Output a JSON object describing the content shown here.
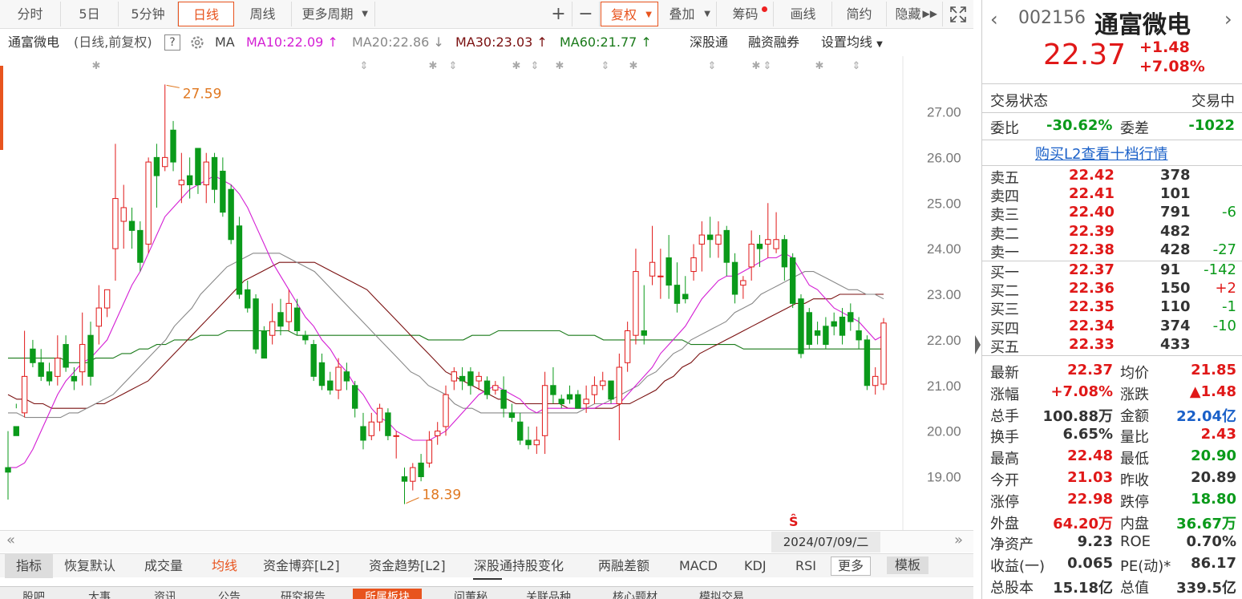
{
  "toolbar": {
    "tabs": [
      "分时",
      "5日",
      "5分钟",
      "日线",
      "周线",
      "更多周期"
    ],
    "active": "日线",
    "right": [
      "+",
      "−",
      "复权",
      "叠加",
      "筹码",
      "画线",
      "简约",
      "隐藏"
    ]
  },
  "ma_row": {
    "stock": "通富微电",
    "mode": "(日线,前复权)",
    "help": "?",
    "ma": "MA",
    "ma10": "MA10:22.09",
    "ma20": "MA20:22.86",
    "ma30": "MA30:23.03",
    "ma60": "MA60:21.77",
    "up": "↑",
    "down": "↓",
    "links": [
      "深股通",
      "融资融券",
      "设置均线"
    ]
  },
  "chart_data": {
    "type": "candlestick",
    "ylim": [
      18.2,
      27.8
    ],
    "yticks": [
      "27.00",
      "26.00",
      "25.00",
      "24.00",
      "23.00",
      "22.00",
      "21.00",
      "20.00",
      "19.00"
    ],
    "max_label": "27.59",
    "min_label": "18.39",
    "date_label": "2024/07/09/二",
    "candles": [
      [
        19.2,
        20.0,
        19.1,
        18.5
      ],
      [
        20.1,
        20.6,
        19.9,
        20.5
      ],
      [
        20.4,
        22.2,
        21.2,
        20.3
      ],
      [
        21.8,
        22.0,
        21.5,
        21.4
      ],
      [
        21.5,
        21.8,
        21.2,
        21.1
      ],
      [
        21.3,
        21.5,
        21.1,
        21.0
      ],
      [
        21.2,
        22.1,
        21.6,
        21.0
      ],
      [
        21.9,
        22.1,
        21.4,
        21.3
      ],
      [
        21.2,
        21.4,
        21.1,
        20.9
      ],
      [
        21.3,
        22.6,
        21.9,
        21.0
      ],
      [
        22.1,
        22.4,
        21.2,
        21.0
      ],
      [
        22.3,
        23.2,
        22.7,
        21.9
      ],
      [
        22.7,
        23.0,
        23.1,
        22.5
      ],
      [
        24.0,
        26.3,
        25.1,
        23.3
      ],
      [
        24.6,
        25.4,
        24.9,
        24.0
      ],
      [
        24.6,
        24.9,
        24.4,
        24.0
      ],
      [
        24.4,
        24.6,
        23.7,
        23.5
      ],
      [
        24.1,
        26.0,
        25.9,
        23.9
      ],
      [
        26.0,
        26.3,
        25.6,
        24.9
      ],
      [
        25.8,
        27.6,
        26.0,
        25.7
      ],
      [
        26.6,
        26.8,
        25.9,
        25.7
      ],
      [
        25.4,
        26.1,
        25.5,
        25.0
      ],
      [
        25.6,
        26.0,
        25.4,
        25.1
      ],
      [
        26.2,
        26.2,
        25.4,
        25.2
      ],
      [
        25.4,
        26.1,
        25.9,
        25.0
      ],
      [
        26.0,
        26.1,
        25.3,
        25.0
      ],
      [
        25.7,
        26.0,
        24.8,
        24.7
      ],
      [
        25.3,
        25.4,
        24.2,
        24.1
      ],
      [
        24.5,
        24.7,
        23.0,
        22.9
      ],
      [
        23.1,
        23.3,
        22.7,
        22.6
      ],
      [
        22.9,
        23.0,
        21.8,
        21.7
      ],
      [
        22.2,
        22.3,
        21.6,
        21.6
      ],
      [
        22.1,
        22.8,
        22.4,
        21.9
      ],
      [
        22.6,
        22.9,
        22.3,
        22.1
      ],
      [
        22.4,
        23.1,
        22.8,
        22.2
      ],
      [
        22.7,
        22.9,
        22.2,
        22.1
      ],
      [
        22.1,
        22.2,
        22.0,
        21.9
      ],
      [
        21.9,
        22.0,
        21.2,
        21.1
      ],
      [
        21.5,
        21.7,
        21.0,
        20.9
      ],
      [
        21.1,
        21.3,
        20.9,
        20.8
      ],
      [
        20.9,
        21.6,
        21.4,
        20.7
      ],
      [
        21.3,
        21.5,
        21.1,
        20.9
      ],
      [
        21.0,
        21.1,
        20.5,
        20.3
      ],
      [
        20.1,
        20.4,
        19.8,
        19.6
      ],
      [
        19.9,
        20.4,
        20.2,
        19.8
      ],
      [
        20.2,
        20.6,
        20.5,
        20.0
      ],
      [
        20.4,
        20.5,
        19.9,
        19.8
      ],
      [
        19.9,
        20.0,
        19.9,
        19.4
      ],
      [
        19.0,
        19.2,
        18.9,
        18.4
      ],
      [
        18.9,
        19.3,
        19.2,
        18.7
      ],
      [
        19.3,
        19.5,
        19.0,
        18.9
      ],
      [
        19.3,
        20.0,
        19.8,
        19.2
      ],
      [
        19.9,
        20.2,
        20.0,
        19.7
      ],
      [
        20.1,
        21.0,
        20.8,
        19.9
      ],
      [
        21.1,
        21.4,
        21.3,
        20.9
      ],
      [
        21.2,
        21.4,
        21.1,
        20.9
      ],
      [
        21.3,
        21.4,
        21.0,
        20.8
      ],
      [
        21.1,
        21.3,
        21.2,
        20.9
      ],
      [
        21.1,
        21.2,
        20.8,
        20.7
      ],
      [
        20.9,
        21.1,
        21.0,
        20.8
      ],
      [
        20.9,
        21.2,
        20.5,
        20.3
      ],
      [
        20.4,
        20.6,
        20.3,
        20.2
      ],
      [
        20.2,
        20.4,
        19.8,
        19.7
      ],
      [
        19.8,
        20.1,
        19.7,
        19.6
      ],
      [
        19.7,
        20.1,
        19.8,
        19.5
      ],
      [
        19.9,
        21.3,
        21.0,
        19.5
      ],
      [
        21.0,
        21.4,
        20.8,
        20.6
      ],
      [
        20.7,
        20.8,
        20.6,
        20.5
      ],
      [
        20.8,
        21.0,
        20.7,
        20.6
      ],
      [
        20.8,
        20.9,
        20.5,
        20.5
      ],
      [
        20.6,
        21.0,
        20.7,
        20.4
      ],
      [
        20.8,
        21.2,
        21.0,
        20.6
      ],
      [
        21.0,
        21.3,
        21.1,
        20.9
      ],
      [
        21.1,
        21.1,
        20.7,
        20.6
      ],
      [
        20.6,
        21.7,
        21.4,
        19.8
      ],
      [
        21.5,
        22.4,
        22.2,
        21.3
      ],
      [
        22.1,
        24.0,
        23.5,
        21.9
      ],
      [
        22.2,
        23.2,
        22.1,
        21.9
      ],
      [
        23.4,
        24.5,
        23.7,
        23.2
      ],
      [
        23.4,
        24.0,
        23.4,
        22.9
      ],
      [
        23.8,
        24.3,
        23.2,
        22.9
      ],
      [
        23.2,
        23.7,
        22.8,
        22.6
      ],
      [
        23.0,
        23.4,
        22.9,
        22.8
      ],
      [
        23.5,
        24.1,
        23.8,
        23.3
      ],
      [
        24.1,
        24.6,
        24.3,
        23.5
      ],
      [
        24.3,
        24.7,
        24.2,
        23.8
      ],
      [
        24.1,
        24.6,
        24.3,
        23.8
      ],
      [
        24.4,
        24.5,
        23.7,
        23.4
      ],
      [
        23.7,
        23.9,
        23.0,
        22.8
      ],
      [
        23.2,
        23.4,
        23.3,
        22.9
      ],
      [
        23.6,
        24.4,
        24.1,
        23.3
      ],
      [
        24.1,
        24.3,
        24.0,
        23.6
      ],
      [
        24.1,
        25.0,
        24.2,
        23.8
      ],
      [
        24.0,
        24.8,
        24.2,
        23.9
      ],
      [
        24.2,
        24.3,
        23.6,
        23.3
      ],
      [
        23.8,
        23.9,
        22.8,
        22.7
      ],
      [
        22.9,
        23.0,
        21.7,
        21.6
      ],
      [
        22.6,
        22.7,
        21.9,
        21.8
      ],
      [
        22.2,
        22.4,
        22.1,
        21.9
      ],
      [
        22.3,
        22.5,
        21.9,
        21.8
      ],
      [
        22.4,
        22.6,
        22.3,
        22.1
      ],
      [
        22.5,
        22.7,
        22.1,
        21.9
      ],
      [
        22.6,
        22.8,
        22.4,
        22.2
      ],
      [
        22.2,
        22.5,
        22.0,
        21.8
      ],
      [
        22.0,
        22.1,
        21.0,
        20.9
      ],
      [
        21.0,
        21.4,
        21.2,
        20.8
      ],
      [
        21.03,
        22.48,
        22.37,
        20.9
      ]
    ],
    "ma_series": {
      "ma10": [
        19.2,
        19.2,
        19.3,
        19.6,
        20.0,
        20.4,
        20.8,
        21.1,
        21.3,
        21.5,
        21.6,
        21.8,
        22.0,
        22.4,
        22.8,
        23.2,
        23.5,
        23.9,
        24.3,
        24.7,
        24.9,
        25.1,
        25.3,
        25.4,
        25.5,
        25.6,
        25.5,
        25.4,
        25.2,
        24.9,
        24.5,
        24.1,
        23.7,
        23.4,
        23.1,
        22.8,
        22.5,
        22.3,
        22.0,
        21.8,
        21.5,
        21.3,
        21.0,
        20.8,
        20.5,
        20.3,
        20.2,
        20.0,
        19.9,
        19.8,
        19.8,
        19.8,
        19.9,
        20.0,
        20.2,
        20.4,
        20.6,
        20.8,
        20.9,
        21.0,
        20.9,
        20.8,
        20.7,
        20.5,
        20.4,
        20.5,
        20.5,
        20.5,
        20.5,
        20.5,
        20.5,
        20.5,
        20.6,
        20.6,
        20.6,
        20.8,
        21.0,
        21.2,
        21.4,
        21.7,
        21.9,
        22.1,
        22.3,
        22.6,
        22.9,
        23.1,
        23.3,
        23.4,
        23.4,
        23.5,
        23.6,
        23.7,
        23.8,
        23.8,
        23.9,
        23.8,
        23.5,
        23.2,
        23.1,
        22.9,
        22.7,
        22.6,
        22.5,
        22.4,
        22.2,
        22.0,
        22.1
      ],
      "ma20": [
        20.4,
        20.4,
        20.3,
        20.3,
        20.3,
        20.3,
        20.3,
        20.4,
        20.4,
        20.5,
        20.6,
        20.7,
        20.8,
        21.0,
        21.2,
        21.4,
        21.6,
        21.8,
        22.0,
        22.3,
        22.5,
        22.7,
        23.0,
        23.2,
        23.4,
        23.6,
        23.7,
        23.8,
        23.9,
        23.9,
        23.9,
        23.9,
        23.8,
        23.7,
        23.6,
        23.5,
        23.3,
        23.1,
        22.9,
        22.7,
        22.5,
        22.3,
        22.1,
        21.9,
        21.7,
        21.5,
        21.3,
        21.2,
        21.0,
        20.9,
        20.8,
        20.6,
        20.5,
        20.5,
        20.4,
        20.4,
        20.4,
        20.4,
        20.4,
        20.4,
        20.4,
        20.4,
        20.4,
        20.4,
        20.4,
        20.4,
        20.5,
        20.6,
        20.6,
        20.7,
        20.8,
        20.9,
        21.0,
        21.2,
        21.3,
        21.5,
        21.7,
        21.8,
        22.0,
        22.1,
        22.2,
        22.3,
        22.4,
        22.6,
        22.7,
        22.8,
        23.0,
        23.1,
        23.2,
        23.3,
        23.4,
        23.5,
        23.5,
        23.4,
        23.3,
        23.2,
        23.1,
        23.1,
        23.0,
        23.0,
        22.9
      ],
      "ma30": [
        20.8,
        20.7,
        20.7,
        20.6,
        20.6,
        20.5,
        20.5,
        20.5,
        20.5,
        20.5,
        20.6,
        20.6,
        20.7,
        20.8,
        20.9,
        21.0,
        21.1,
        21.3,
        21.5,
        21.7,
        21.9,
        22.1,
        22.3,
        22.5,
        22.7,
        22.9,
        23.1,
        23.3,
        23.4,
        23.5,
        23.6,
        23.7,
        23.7,
        23.7,
        23.7,
        23.7,
        23.6,
        23.5,
        23.4,
        23.3,
        23.2,
        23.1,
        22.9,
        22.7,
        22.5,
        22.3,
        22.1,
        21.9,
        21.7,
        21.5,
        21.3,
        21.2,
        21.1,
        21.0,
        20.9,
        20.8,
        20.7,
        20.7,
        20.6,
        20.6,
        20.6,
        20.6,
        20.6,
        20.6,
        20.5,
        20.5,
        20.5,
        20.5,
        20.5,
        20.5,
        20.6,
        20.6,
        20.7,
        20.8,
        20.9,
        21.1,
        21.2,
        21.4,
        21.5,
        21.7,
        21.8,
        21.9,
        22.0,
        22.1,
        22.2,
        22.3,
        22.4,
        22.5,
        22.6,
        22.7,
        22.8,
        22.8,
        22.9,
        22.9,
        22.9,
        23.0,
        23.0,
        23.0,
        23.0,
        23.0,
        23.0
      ],
      "ma60": [
        21.6,
        21.6,
        21.6,
        21.6,
        21.6,
        21.6,
        21.6,
        21.5,
        21.5,
        21.5,
        21.6,
        21.6,
        21.6,
        21.7,
        21.7,
        21.8,
        21.8,
        21.9,
        21.9,
        22.0,
        22.0,
        22.0,
        22.1,
        22.1,
        22.1,
        22.2,
        22.2,
        22.2,
        22.2,
        22.2,
        22.2,
        22.2,
        22.2,
        22.1,
        22.1,
        22.1,
        22.1,
        22.1,
        22.1,
        22.1,
        22.1,
        22.1,
        22.1,
        22.1,
        22.1,
        22.1,
        22.1,
        22.1,
        22.0,
        22.0,
        22.0,
        22.0,
        22.0,
        22.1,
        22.1,
        22.1,
        22.2,
        22.2,
        22.2,
        22.2,
        22.2,
        22.2,
        22.2,
        22.2,
        22.1,
        22.1,
        22.1,
        22.1,
        22.0,
        22.0,
        22.0,
        22.0,
        22.0,
        22.0,
        22.0,
        22.0,
        22.0,
        22.0,
        21.9,
        21.9,
        21.9,
        21.9,
        21.9,
        21.9,
        21.8,
        21.8,
        21.8,
        21.8,
        21.8,
        21.8,
        21.8,
        21.8,
        21.8,
        21.8,
        21.8,
        21.8,
        21.8,
        21.8,
        21.8,
        21.8,
        21.8
      ]
    }
  },
  "scroll": {
    "left": "«",
    "right": "»"
  },
  "indicator_tabs": [
    "指标",
    "恢复默认",
    "成交量",
    "均线",
    "资金博弈[L2]",
    "资金趋势[L2]",
    "深股通持股变化",
    "两融差额",
    "MACD",
    "KDJ",
    "RSI",
    "更多",
    "模板"
  ],
  "news_tabs": [
    "股吧",
    "大事",
    "资讯",
    "公告",
    "研究报告",
    "所属板块",
    "问董秘",
    "关联品种",
    "核心题材",
    "模拟交易"
  ],
  "quote": {
    "code": "002156",
    "name": "通富微电",
    "price": "22.37",
    "change": "+1.48",
    "pct": "+7.08%",
    "status_label": "交易状态",
    "status": "交易中",
    "weibi_label": "委比",
    "weibi": "-30.62%",
    "weicha_label": "委差",
    "weicha": "-1022",
    "l2_link": "购买L2查看十档行情",
    "asks": [
      {
        "label": "卖五",
        "price": "22.42",
        "vol": "378",
        "chg": ""
      },
      {
        "label": "卖四",
        "price": "22.41",
        "vol": "101",
        "chg": ""
      },
      {
        "label": "卖三",
        "price": "22.40",
        "vol": "791",
        "chg": "-6"
      },
      {
        "label": "卖二",
        "price": "22.39",
        "vol": "482",
        "chg": ""
      },
      {
        "label": "卖一",
        "price": "22.38",
        "vol": "428",
        "chg": "-27"
      }
    ],
    "bids": [
      {
        "label": "买一",
        "price": "22.37",
        "vol": "91",
        "chg": "-142"
      },
      {
        "label": "买二",
        "price": "22.36",
        "vol": "150",
        "chg": "+2"
      },
      {
        "label": "买三",
        "price": "22.35",
        "vol": "110",
        "chg": "-1"
      },
      {
        "label": "买四",
        "price": "22.34",
        "vol": "374",
        "chg": "-10"
      },
      {
        "label": "买五",
        "price": "22.33",
        "vol": "433",
        "chg": ""
      }
    ],
    "stats": [
      [
        "最新",
        "22.37",
        "r",
        "均价",
        "21.85",
        "r"
      ],
      [
        "涨幅",
        "+7.08%",
        "r",
        "涨跌",
        "▲1.48",
        "r"
      ],
      [
        "总手",
        "100.88万",
        "k",
        "金额",
        "22.04亿",
        "b"
      ],
      [
        "换手",
        "6.65%",
        "k",
        "量比",
        "2.43",
        "r"
      ],
      [
        "最高",
        "22.48",
        "r",
        "最低",
        "20.90",
        "g"
      ],
      [
        "今开",
        "21.03",
        "r",
        "昨收",
        "20.89",
        "k"
      ],
      [
        "涨停",
        "22.98",
        "r",
        "跌停",
        "18.80",
        "g"
      ],
      [
        "外盘",
        "64.20万",
        "r",
        "内盘",
        "36.67万",
        "g"
      ],
      [
        "净资产",
        "9.23",
        "k",
        "ROE",
        "0.70%",
        "k"
      ],
      [
        "收益(一)",
        "0.065",
        "k",
        "PE(动)*",
        "86.17",
        "k"
      ],
      [
        "总股本",
        "15.18亿",
        "k",
        "总值",
        "339.5亿",
        "k"
      ]
    ]
  },
  "colors": {
    "up": "#e01818",
    "down": "#0a9a1a",
    "ma10": "#d41ed4",
    "ma20": "#888888",
    "ma30": "#7a1010",
    "ma60": "#1a7a1a",
    "accent": "#e8541e"
  }
}
